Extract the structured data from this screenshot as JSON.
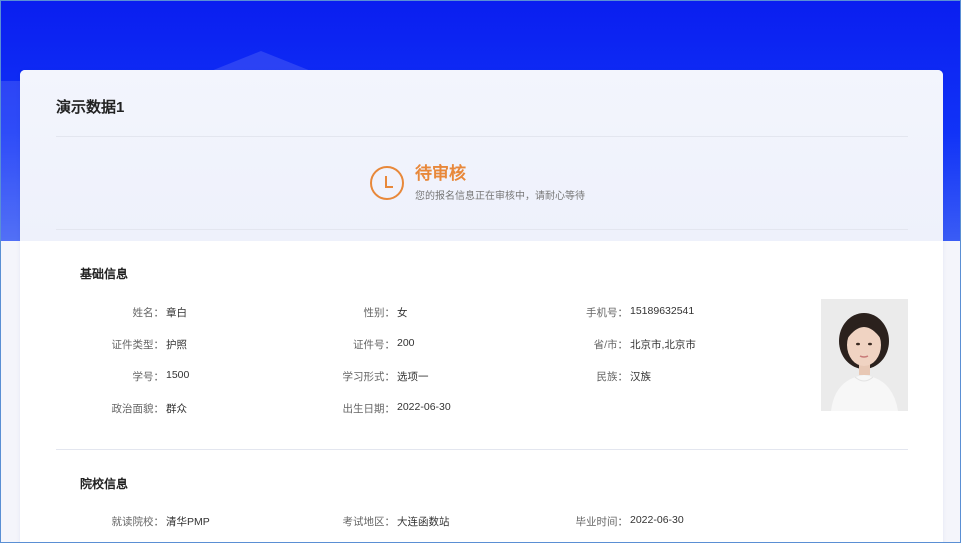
{
  "card": {
    "title": "演示数据1"
  },
  "status": {
    "title": "待审核",
    "description": "您的报名信息正在审核中，请耐心等待",
    "icon": "clock-icon",
    "color": "#e8883a"
  },
  "basic_info": {
    "section_title": "基础信息",
    "fields": [
      {
        "label": "姓名：",
        "value": "章白"
      },
      {
        "label": "性别：",
        "value": "女"
      },
      {
        "label": "手机号：",
        "value": "15189632541"
      },
      {
        "label": "证件类型：",
        "value": "护照"
      },
      {
        "label": "证件号：",
        "value": "200"
      },
      {
        "label": "省/市：",
        "value": "北京市,北京市"
      },
      {
        "label": "学号：",
        "value": "1500"
      },
      {
        "label": "学习形式：",
        "value": "选项一"
      },
      {
        "label": "民族：",
        "value": "汉族"
      },
      {
        "label": "政治面貌：",
        "value": "群众"
      },
      {
        "label": "出生日期：",
        "value": "2022-06-30"
      }
    ]
  },
  "school_info": {
    "section_title": "院校信息",
    "fields": [
      {
        "label": "就读院校：",
        "value": "清华PMP"
      },
      {
        "label": "考试地区：",
        "value": "大连函数站"
      },
      {
        "label": "毕业时间：",
        "value": "2022-06-30"
      }
    ]
  },
  "colors": {
    "banner": "#0a1ef0",
    "accent": "#e8883a"
  }
}
